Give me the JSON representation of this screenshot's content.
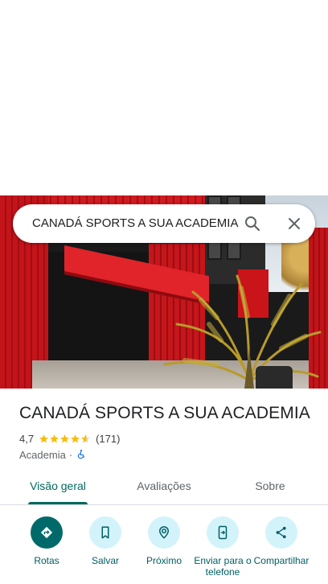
{
  "search": {
    "query": "CANADÁ SPORTS A SUA ACADEMIA"
  },
  "place": {
    "name": "CANADÁ SPORTS A SUA ACADEMIA",
    "rating": "4,7",
    "rating_value": 4.7,
    "reviews": "(171)",
    "category": "Academia",
    "separator": "·",
    "accessibility_icon": "wheelchair-icon"
  },
  "tabs": [
    {
      "label": "Visão geral",
      "active": true
    },
    {
      "label": "Avaliações",
      "active": false
    },
    {
      "label": "Sobre",
      "active": false
    }
  ],
  "actions": [
    {
      "label": "Rotas",
      "icon": "directions-icon"
    },
    {
      "label": "Salvar",
      "icon": "bookmark-icon"
    },
    {
      "label": "Próximo",
      "icon": "nearby-icon"
    },
    {
      "label": "Enviar para o telefone",
      "icon": "send-to-phone-icon"
    },
    {
      "label": "Compartilhar",
      "icon": "share-icon"
    }
  ],
  "colors": {
    "accent": "#00695c",
    "star": "#fbbc04",
    "action_bg": "#d3f3fb",
    "primary_action_bg": "#006a6a",
    "accessibility": "#1a73e8"
  }
}
